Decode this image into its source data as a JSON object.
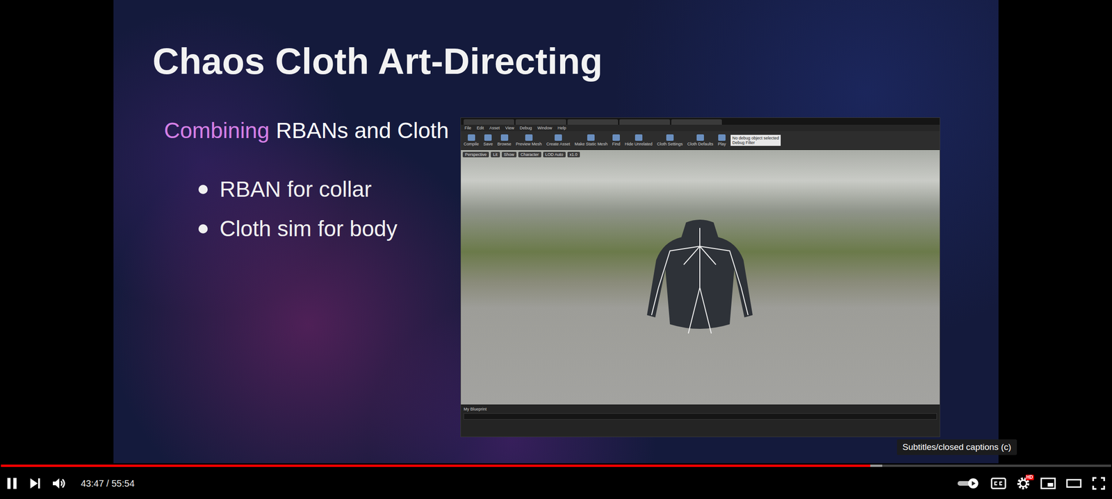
{
  "slide": {
    "title": "Chaos Cloth Art-Directing",
    "subtitle": {
      "highlight": "Combining",
      "rest": "RBANs and Cloth"
    },
    "bullets": [
      "RBAN for collar",
      "Cloth sim for body"
    ]
  },
  "editor": {
    "menu": [
      "File",
      "Edit",
      "Asset",
      "View",
      "Debug",
      "Window",
      "Help"
    ],
    "toolbar": [
      "Compile",
      "Save",
      "Browse",
      "Preview Mesh",
      "Create Asset",
      "Make Static Mesh",
      "Find",
      "Hide Unrelated",
      "Cloth Settings",
      "Cloth Defaults",
      "Play"
    ],
    "debug_object": "No debug object selected",
    "debug_filter": "Debug Filter",
    "viewport_buttons": [
      "Perspective",
      "Lit",
      "Show",
      "Character",
      "LOD Auto",
      "x1.0"
    ],
    "bottom_panel": "My Blueprint"
  },
  "player": {
    "playing": true,
    "progress": {
      "level": 0.783,
      "buffered_level": 0.794
    },
    "time": "43:47 / 55:54",
    "autoplay": {
      "on": true
    },
    "quality_badge": "HD",
    "tooltip": "Subtitles/closed captions (c)"
  }
}
